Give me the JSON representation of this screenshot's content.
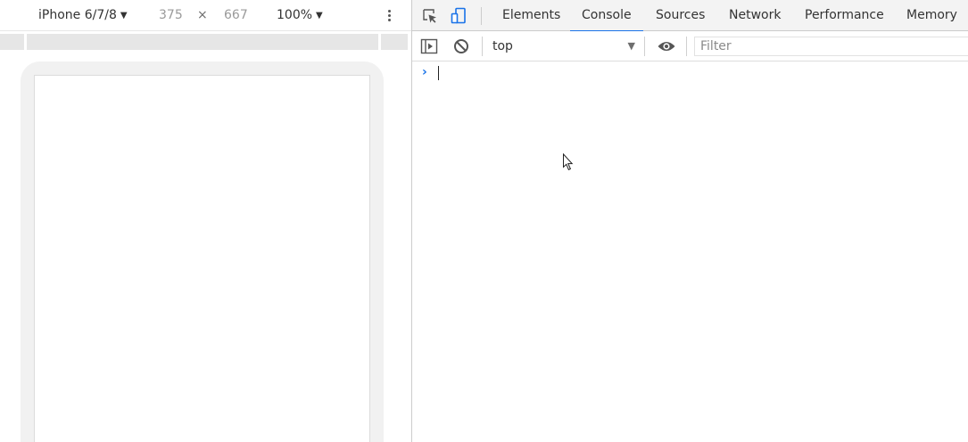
{
  "device_toolbar": {
    "device_name": "iPhone 6/7/8",
    "dropdown_arrow": "▼",
    "width_value": "375",
    "dimension_separator": "×",
    "height_value": "667",
    "zoom": "100%"
  },
  "devtools": {
    "tabs": [
      {
        "label": "Elements",
        "active": false
      },
      {
        "label": "Console",
        "active": true
      },
      {
        "label": "Sources",
        "active": false
      },
      {
        "label": "Network",
        "active": false
      },
      {
        "label": "Performance",
        "active": false
      },
      {
        "label": "Memory",
        "active": false
      }
    ],
    "toolbar_icons": [
      "inspect-element-icon",
      "device-toolbar-icon"
    ]
  },
  "console_toolbar": {
    "icons": [
      "sidebar-toggle-icon",
      "clear-console-icon",
      "eye-icon"
    ],
    "context": "top",
    "context_arrow": "▼",
    "filter_placeholder": "Filter",
    "filter_value": ""
  },
  "console": {
    "prompt_symbol": "›",
    "input_value": ""
  },
  "colors": {
    "accent": "#1a73e8",
    "tabbar_bg": "#f3f3f3",
    "device_frame": "#f1f1f1",
    "ruler": "#e6e6e6",
    "divider": "#cccccc"
  }
}
